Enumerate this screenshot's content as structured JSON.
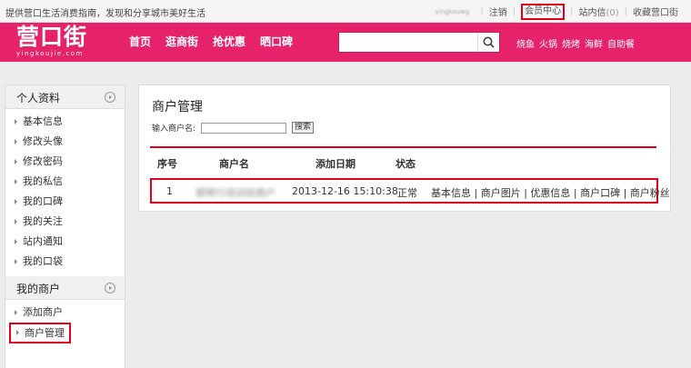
{
  "topbar": {
    "slogan": "提供营口生活消费指南，发现和分享城市美好生活",
    "username": "yingkouwg",
    "logout": "注销",
    "member_center": "会员中心",
    "messages": "站内信",
    "message_count": "(0)",
    "favorite": "收藏营口街"
  },
  "header": {
    "logo_text": "营口街",
    "logo_sub": "yingkoujie.com",
    "nav": [
      "首页",
      "逛商街",
      "抢优惠",
      "晒口碑"
    ],
    "search_placeholder": "",
    "hot": [
      "烧鱼",
      "火锅",
      "烧烤",
      "海鲜",
      "自助餐"
    ],
    "colors": {
      "brand": "#e6226b",
      "highlight": "#e0001e"
    }
  },
  "sidebar": {
    "section1": "个人资料",
    "items1": [
      "基本信息",
      "修改头像",
      "修改密码",
      "我的私信",
      "我的口碑",
      "我的关注",
      "站内通知",
      "我的口袋"
    ],
    "section2": "我的商户",
    "items2": [
      "添加商户",
      "商户管理"
    ]
  },
  "main": {
    "title": "商户管理",
    "search_label": "输入商户名:",
    "search_value": "",
    "search_button": "搜索",
    "columns": [
      "序号",
      "商户名",
      "添加日期",
      "状态"
    ],
    "rows": [
      {
        "index": "1",
        "name": "钢琴行培训班商户",
        "date": "2013-12-16 15:10:38",
        "status": "正常",
        "actions": [
          "基本信息",
          "商户图片",
          "优惠信息",
          "商户口碑",
          "商户粉丝"
        ]
      }
    ]
  }
}
